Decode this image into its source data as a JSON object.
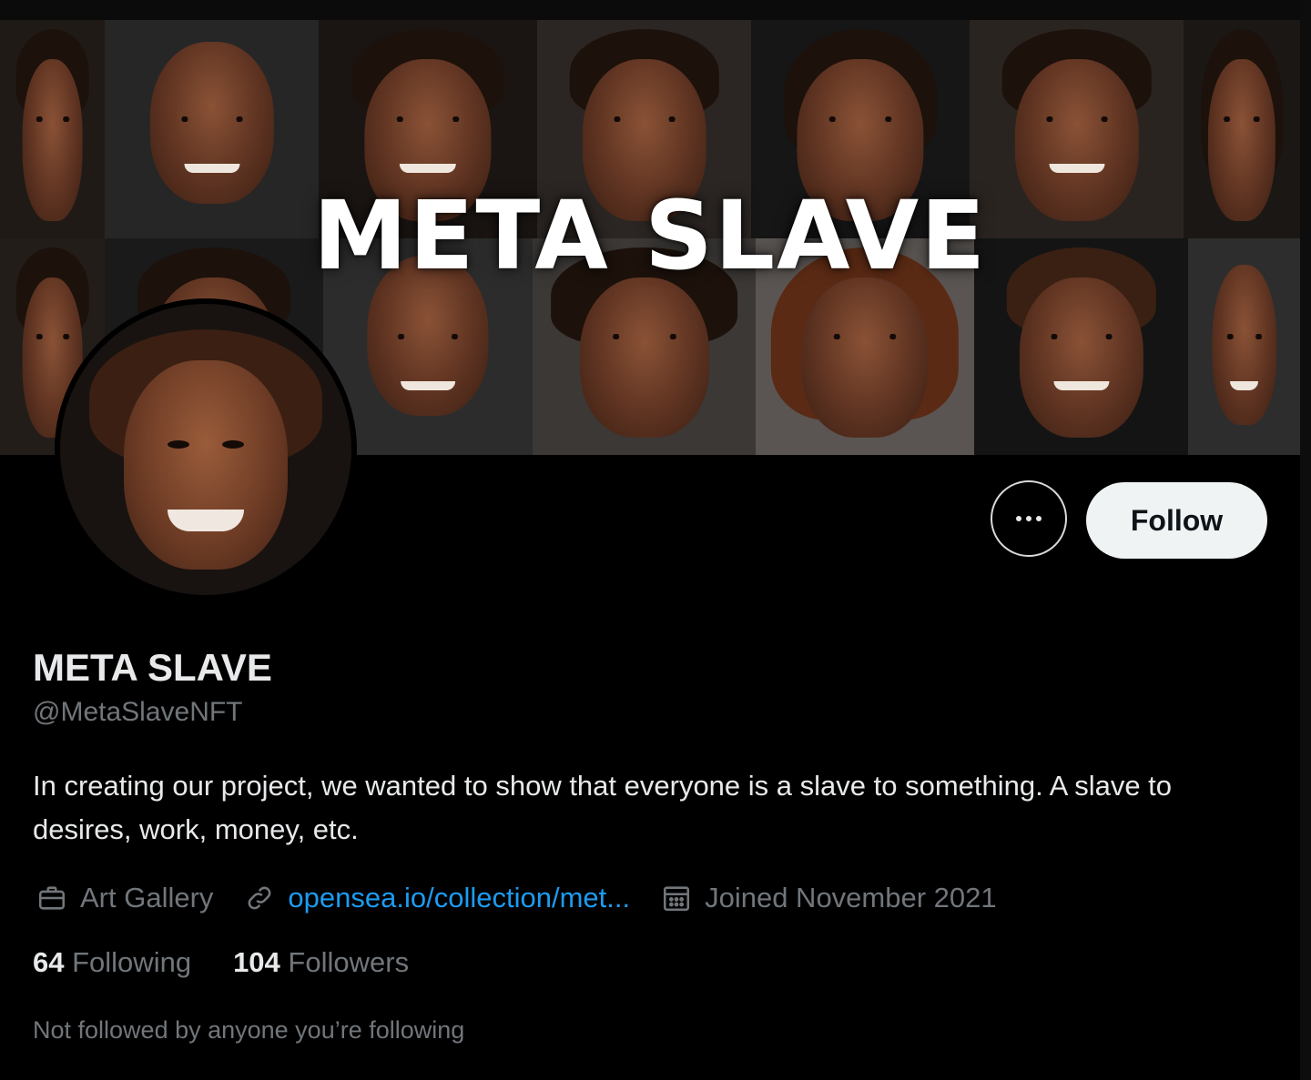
{
  "banner": {
    "title": "META SLAVE"
  },
  "profile": {
    "display_name": "META SLAVE",
    "handle": "@MetaSlaveNFT",
    "bio": "In creating our project, we wanted to show that everyone is a slave to something. A slave to desires, work, money, etc.",
    "category": "Art Gallery",
    "category_icon": "briefcase-icon",
    "website": "opensea.io/collection/met...",
    "website_icon": "link-icon",
    "joined": "Joined November 2021",
    "joined_icon": "calendar-icon",
    "following_count": "64",
    "following_label": "Following",
    "followers_count": "104",
    "followers_label": "Followers",
    "not_followed_note": "Not followed by anyone you’re following"
  },
  "actions": {
    "more_icon": "more-options-icon",
    "follow_label": "Follow"
  },
  "colors": {
    "background": "#000000",
    "text_primary": "#e7e9ea",
    "text_secondary": "#71767b",
    "link": "#1d9bf0",
    "follow_button_bg": "#eff3f4"
  }
}
